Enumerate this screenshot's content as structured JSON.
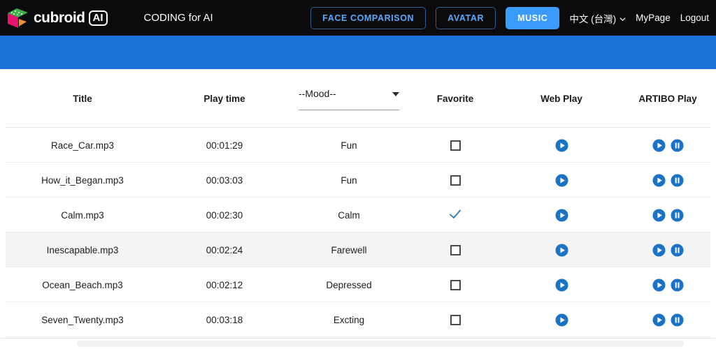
{
  "header": {
    "brand_word": "cubroid",
    "brand_badge": "AI",
    "tagline": "CODING for AI",
    "buttons": [
      {
        "label": "FACE COMPARISON",
        "active": false
      },
      {
        "label": "AVATAR",
        "active": false
      },
      {
        "label": "MUSIC",
        "active": true
      }
    ],
    "language": "中文 (台灣)",
    "mypage": "MyPage",
    "logout": "Logout",
    "colors": {
      "bar_background": "#0b0b0d",
      "accent_blue": "#3b9bfb",
      "button_border": "#2e5d91",
      "banner_blue": "#1b72d9"
    }
  },
  "table": {
    "columns": {
      "title": "Title",
      "play_time": "Play time",
      "mood": "--Mood--",
      "favorite": "Favorite",
      "web_play": "Web Play",
      "artibo_play": "ARTIBO Play"
    },
    "rows": [
      {
        "title": "Race_Car.mp3",
        "play_time": "00:01:29",
        "mood": "Fun",
        "favorite": false,
        "highlighted": false
      },
      {
        "title": "How_it_Began.mp3",
        "play_time": "00:03:03",
        "mood": "Fun",
        "favorite": false,
        "highlighted": false
      },
      {
        "title": "Calm.mp3",
        "play_time": "00:02:30",
        "mood": "Calm",
        "favorite": true,
        "highlighted": false
      },
      {
        "title": "Inescapable.mp3",
        "play_time": "00:02:24",
        "mood": "Farewell",
        "favorite": false,
        "highlighted": true
      },
      {
        "title": "Ocean_Beach.mp3",
        "play_time": "00:02:12",
        "mood": "Depressed",
        "favorite": false,
        "highlighted": false
      },
      {
        "title": "Seven_Twenty.mp3",
        "play_time": "00:03:18",
        "mood": "Excting",
        "favorite": false,
        "highlighted": false
      }
    ]
  }
}
